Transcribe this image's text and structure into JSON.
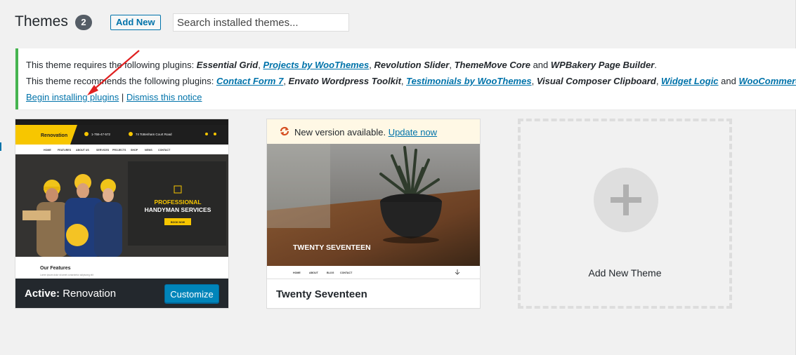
{
  "header": {
    "title": "Themes",
    "count": "2",
    "add_new": "Add New",
    "search_placeholder": "Search installed themes..."
  },
  "notice": {
    "line1_prefix": "This theme requires the following plugins: ",
    "required": [
      "Essential Grid",
      "Projects by WooThemes",
      "Revolution Slider",
      "ThemeMove Core",
      "WPBakery Page Builder"
    ],
    "line2_prefix": "This theme recommends the following plugins: ",
    "recommended": [
      "Contact Form 7",
      "Envato Wordpress Toolkit",
      "Testimonials by WooThemes",
      "Visual Composer Clipboard",
      "Widget Logic",
      "WooCommerce"
    ],
    "sep_comma": ", ",
    "and": " and ",
    "period": ".",
    "begin_installing": "Begin installing plugins",
    "pipe": " | ",
    "dismiss": "Dismiss this notice"
  },
  "themes": [
    {
      "active_prefix": "Active:",
      "name": "Renovation",
      "customize": "Customize",
      "screenshot": {
        "brand": "Renovation",
        "phone": "1-755-47-572",
        "address": "74 Tottenham Court Road",
        "menu": [
          "HOME",
          "FEATURES",
          "ABOUT US",
          "SERVICES",
          "PROJECTS",
          "SHOP",
          "NEWS",
          "CONTACT"
        ],
        "hero_line1": "PROFESSIONAL",
        "hero_line2": "HANDYMAN SERVICES",
        "hero_button": "BOOK NOW",
        "section_title": "Our Features",
        "section_text": "Lorem ipsum dolor sit amet consectetur adipiscing elit"
      }
    },
    {
      "name": "Twenty Seventeen",
      "update_text": "New version available. ",
      "update_link": "Update now",
      "screenshot": {
        "hero_text": "TWENTY SEVENTEEN",
        "menu": [
          "HOME",
          "ABOUT",
          "BLOG",
          "CONTACT"
        ]
      }
    }
  ],
  "add_new_theme": "Add New Theme",
  "colors": {
    "accent": "#0073aa",
    "notice_border": "#46b450",
    "renovation_yellow": "#f7c600",
    "active_footer": "#23282d",
    "customize": "#0085ba",
    "annotation_arrow": "#e02020"
  }
}
